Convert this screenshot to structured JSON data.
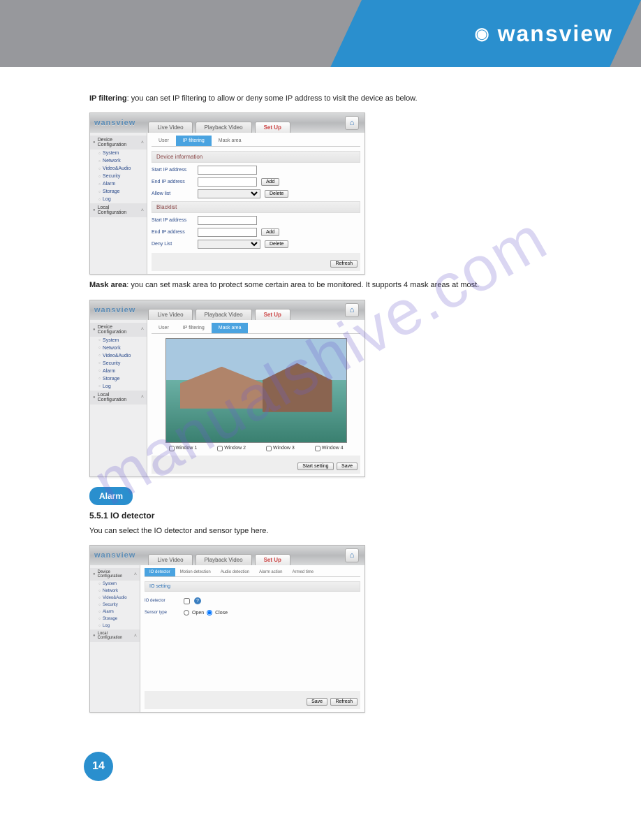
{
  "brand": "wansview",
  "watermark": "manualshive.com",
  "page_number": "14",
  "topbar": {
    "tabs": [
      "Live Video",
      "Playback Video",
      "Set Up"
    ],
    "active": 2
  },
  "sidebar": {
    "group1": "Device Configuration",
    "items": [
      "System",
      "Network",
      "Video&Audio",
      "Security",
      "Alarm",
      "Storage",
      "Log"
    ],
    "group2": "Local Configuration"
  },
  "section_ip_filter": {
    "intro_bold": "IP filtering",
    "intro_text": ": you can set IP filtering to allow or deny some IP address to visit the device as below.",
    "subtabs": [
      "User",
      "IP filtering",
      "Mask area"
    ],
    "active": 1,
    "panel_title": "Device information",
    "rows": {
      "start_ip": "Start IP address",
      "end_ip": "End IP address",
      "allow_list": "Allow list",
      "blacklist_header": "Blacklist",
      "deny_list": "Deny List"
    },
    "buttons": {
      "add": "Add",
      "delete": "Delete",
      "refresh": "Refresh"
    }
  },
  "section_mask": {
    "intro_bold": "Mask area",
    "intro_text": ": you can set mask area to protect some certain area to be monitored. It supports 4 mask areas at most.",
    "subtabs": [
      "User",
      "IP filtering",
      "Mask area"
    ],
    "active": 2,
    "windows": [
      "Window 1",
      "Window 2",
      "Window 3",
      "Window 4"
    ],
    "buttons": {
      "start": "Start setting",
      "save": "Save"
    }
  },
  "alarm_badge": "Alarm",
  "section_io": {
    "title": "5.5.1 IO detector",
    "desc": "You can select the IO detector and sensor type here.",
    "subtabs": [
      "IO detector",
      "Motion detection",
      "Audio detection",
      "Alarm action",
      "Armed time"
    ],
    "active": 0,
    "panel_title": "IO setting",
    "rows": {
      "io_detector": "IO detector",
      "sensor_type": "Sensor type",
      "open": "Open",
      "close": "Close"
    },
    "buttons": {
      "save": "Save",
      "refresh": "Refresh"
    }
  }
}
